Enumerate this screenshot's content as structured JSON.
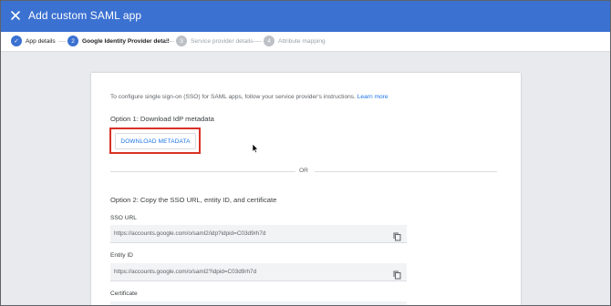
{
  "header": {
    "title": "Add custom SAML app",
    "close_icon": "close-icon",
    "bg_color": "#3b71d1"
  },
  "stepper": {
    "steps": [
      {
        "marker": "✓",
        "label": "App details",
        "state": "done"
      },
      {
        "marker": "2",
        "label": "Google Identity Provider detail",
        "state": "active"
      },
      {
        "marker": "3",
        "label": "Service provider details",
        "state": "pending"
      },
      {
        "marker": "4",
        "label": "Attribute mapping",
        "state": "pending"
      }
    ]
  },
  "card": {
    "intro_text": "To configure single sign-on (SSO) for SAML apps, follow your service provider's instructions.",
    "learn_more": "Learn more",
    "option1_title": "Option 1: Download IdP metadata",
    "download_button": "DOWNLOAD METADATA",
    "or_text": "OR",
    "option2_title": "Option 2: Copy the SSO URL, entity ID, and certificate",
    "fields": [
      {
        "label": "SSO URL",
        "value": "https://accounts.google.com/o/saml2/idp?idpid=C03d9rh7d"
      },
      {
        "label": "Entity ID",
        "value": "https://accounts.google.com/o/saml2?idpid=C03d9rh7d"
      },
      {
        "label": "Certificate",
        "value": ""
      }
    ]
  },
  "colors": {
    "accent": "#1a73e8",
    "highlight": "#d93025",
    "background_grey": "#e8eaed"
  }
}
